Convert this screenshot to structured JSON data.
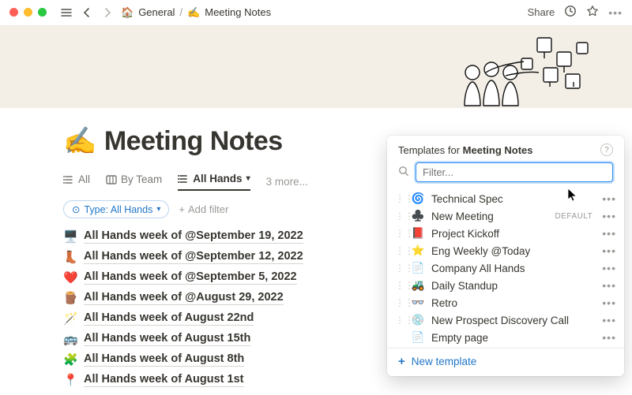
{
  "breadcrumb": {
    "parent_icon": "🏠",
    "parent": "General",
    "child_icon": "✍️",
    "child": "Meeting Notes"
  },
  "toolbar": {
    "share": "Share"
  },
  "page": {
    "icon": "✍️",
    "title": "Meeting Notes"
  },
  "tabs": [
    {
      "icon": "list",
      "label": "All"
    },
    {
      "icon": "board",
      "label": "By Team"
    },
    {
      "icon": "list",
      "label": "All Hands",
      "active": true,
      "chevron": true
    }
  ],
  "tabs_more": "3 more...",
  "filter_pill": {
    "icon": "⊙",
    "label": "Type: All Hands"
  },
  "add_filter": "Add filter",
  "list_items": [
    {
      "emoji": "🖥️",
      "text": "All Hands week of @September 19, 2022"
    },
    {
      "emoji": "👢",
      "text": "All Hands week of @September 12, 2022"
    },
    {
      "emoji": "❤️",
      "text": "All Hands week of @September 5, 2022"
    },
    {
      "emoji": "🪵",
      "text": "All Hands week of @August 29, 2022"
    },
    {
      "emoji": "🪄",
      "text": "All Hands week of August 22nd"
    },
    {
      "emoji": "🚌",
      "text": "All Hands week of August 15th"
    },
    {
      "emoji": "🧩",
      "text": "All Hands week of August 8th"
    },
    {
      "emoji": "📍",
      "text": "All Hands week of August 1st"
    }
  ],
  "panel": {
    "title_prefix": "Templates for",
    "title_subject": "Meeting Notes",
    "filter_placeholder": "Filter...",
    "new_template": "New template",
    "templates": [
      {
        "icon": "🌀",
        "name": "Technical Spec",
        "more": true
      },
      {
        "icon": "♣️",
        "name": "New Meeting",
        "default": true,
        "default_label": "DEFAULT",
        "more": true
      },
      {
        "icon": "📕",
        "name": "Project Kickoff",
        "more": true
      },
      {
        "icon": "⭐",
        "name": "Eng Weekly @Today",
        "more": true
      },
      {
        "icon": "📄",
        "name": "Company All Hands",
        "more": true
      },
      {
        "icon": "🚜",
        "name": "Daily Standup",
        "more": true
      },
      {
        "icon": "👓",
        "name": "Retro",
        "more": true
      },
      {
        "icon": "💿",
        "name": "New Prospect Discovery Call",
        "more": true
      },
      {
        "icon": "📄",
        "name": "Empty page",
        "more": true,
        "no_drag": true
      }
    ]
  }
}
